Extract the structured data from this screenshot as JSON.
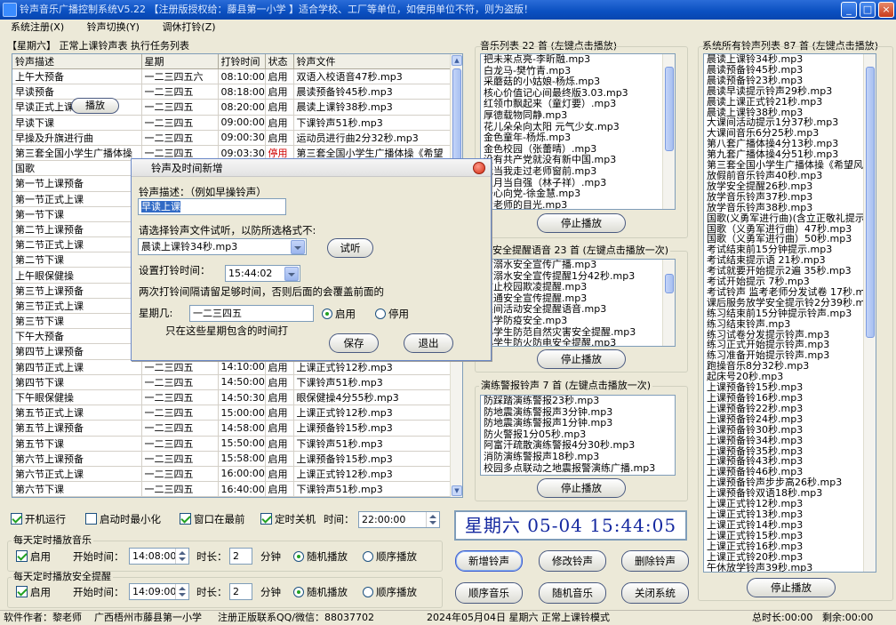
{
  "window": {
    "title": "铃声音乐广播控制系统V5.22 【注册版授权给：藤县第一小学 】适合学校、工厂等单位，如使用单位不符，则为盗版！",
    "btn_min": "_",
    "btn_max": "□",
    "btn_close": "×"
  },
  "menu": [
    "系统注册(X)",
    "铃声切换(Y)",
    "调休打铃(Z)"
  ],
  "schedule": {
    "title": "【星期六】 正常上课铃声表  执行任务列表",
    "columns": [
      "铃声描述",
      "星期",
      "打铃时间",
      "状态",
      "铃声文件"
    ],
    "rows": [
      [
        "上午大预备",
        "一二三四五六",
        "08:10:00",
        "启用",
        "双语入校语音47秒.mp3"
      ],
      [
        "早读预备",
        "一二三四五",
        "08:18:00",
        "启用",
        "晨读预备铃45秒.mp3"
      ],
      [
        "早读正式上课",
        "一二三四五",
        "08:20:00",
        "启用",
        "晨读上课铃38秒.mp3"
      ],
      [
        "早读下课",
        "一二三四五",
        "09:00:00",
        "启用",
        "下课铃声51秒.mp3"
      ],
      [
        "早操及升旗进行曲",
        "一二三四五",
        "09:00:30",
        "启用",
        "运动员进行曲2分32秒.mp3"
      ],
      [
        "第三套全国小学生广播体操",
        "一二三四五",
        "09:03:30",
        "停用",
        "第三套全国小学生广播体操《希望"
      ],
      [
        "国歌",
        "",
        "",
        "",
        ""
      ],
      [
        "第一节上课预备",
        "",
        "",
        "",
        ""
      ],
      [
        "第一节正式上课",
        "",
        "",
        "",
        ""
      ],
      [
        "第一节下课",
        "",
        "",
        "",
        ""
      ],
      [
        "第二节上课预备",
        "",
        "",
        "",
        ""
      ],
      [
        "第二节正式上课",
        "",
        "",
        "",
        ""
      ],
      [
        "第二节下课",
        "",
        "",
        "",
        ""
      ],
      [
        "上午眼保健操",
        "",
        "",
        "",
        ""
      ],
      [
        "第三节上课预备",
        "",
        "",
        "",
        ""
      ],
      [
        "第三节正式上课",
        "",
        "",
        "",
        ""
      ],
      [
        "第三节下课",
        "",
        "",
        "",
        ""
      ],
      [
        "下午大预备",
        "",
        "",
        "",
        ""
      ],
      [
        "第四节上课预备",
        "",
        "",
        "",
        ""
      ],
      [
        "第四节正式上课",
        "一二三四五",
        "14:10:00",
        "启用",
        "上课正式铃12秒.mp3"
      ],
      [
        "第四节下课",
        "一二三四五",
        "14:50:00",
        "启用",
        "下课铃声51秒.mp3"
      ],
      [
        "下午眼保健操",
        "一二三四五",
        "14:50:30",
        "启用",
        "眼保健操4分55秒.mp3"
      ],
      [
        "第五节正式上课",
        "一二三四五",
        "15:00:00",
        "启用",
        "上课正式铃12秒.mp3"
      ],
      [
        "第五节上课预备",
        "一二三四五",
        "14:58:00",
        "启用",
        "上课预备铃15秒.mp3"
      ],
      [
        "第五节下课",
        "一二三四五",
        "15:50:00",
        "启用",
        "下课铃声51秒.mp3"
      ],
      [
        "第六节上课预备",
        "一二三四五",
        "15:58:00",
        "启用",
        "上课预备铃15秒.mp3"
      ],
      [
        "第六节正式上课",
        "一二三四五",
        "16:00:00",
        "启用",
        "上课正式铃12秒.mp3"
      ],
      [
        "第六节下课",
        "一二三四五",
        "16:40:00",
        "启用",
        "下课铃声51秒.mp3"
      ]
    ],
    "play_label": "播放"
  },
  "music": {
    "title": "音乐列表 22 首 (左键点击播放)",
    "items": [
      "把未来点亮-李昕融.mp3",
      "白龙马-樊竹青.mp3",
      "采蘑菇的小姑娘-杨烁.mp3",
      "核心价值记心间最终版3.03.mp3",
      "红领巾飘起来（童灯要）.mp3",
      "厚德载物同静.mp3",
      "花儿朵朵向太阳 元气少女.mp3",
      "金色童年-杨烁.mp3",
      "金色校园（张蕾晴）.mp3",
      "没有共产党就没有新中国.mp3",
      "我当我走过老师窗前.mp3",
      "八月当自强（林子祥）.mp3",
      "一心向党-徐金慧.mp3",
      "爱老师的目光.mp3"
    ],
    "stop": "停止播放"
  },
  "safety": {
    "title": "安全提醒语音 23 首 (左键点击播放一次)",
    "items": [
      "防溺水安全宣传广播.mp3",
      "防溺水安全宣传提醒1分42秒.mp3",
      "防止校园欺凌提醒.mp3",
      "交通安全宣传提醒.mp3",
      "课间活动安全提醒语音.mp3",
      "小学防疫安全.mp3",
      "小学生防范自然灾害安全提醒.mp3",
      "小学生防火防电安全提醒.mp3"
    ],
    "stop": "停止播放"
  },
  "drill": {
    "title": "演练警报铃声 7 首 (左键点击播放一次)",
    "items": [
      "防踩踏演练警报23秒.mp3",
      "防地震演练警报声3分钟.mp3",
      "防地震演练警报声1分钟.mp3",
      "防火警报1分05秒.mp3",
      "阿富汗疏散演练警报4分30秒.mp3",
      "消防演练警报声18秒.mp3",
      "校园多点联动之地震报警演练广播.mp3"
    ],
    "stop": "停止播放"
  },
  "system": {
    "title": "系统所有铃声列表 87 首 (左键点击播放)",
    "items": [
      "晨读上课铃34秒.mp3",
      "晨读预备铃45秒.mp3",
      "晨读预备铃23秒.mp3",
      "晨读早读提示铃声29秒.mp3",
      "晨读上课正式铃21秒.mp3",
      "晨读上课铃38秒.mp3",
      "大课间活动提示1分37秒.mp3",
      "大课间音乐6分25秒.mp3",
      "第八套广播体操4分13秒.mp3",
      "第九套广播体操4分51秒.mp3",
      "第三套全国小学生广播体操《希望风",
      "放假前音乐铃声40秒.mp3",
      "放学安全提醒26秒.mp3",
      "放学音乐铃声37秒.mp3",
      "放学音乐铃声38秒.mp3",
      "国歌(义勇军进行曲)(含立正敬礼提示",
      "国歌（义勇军进行曲）47秒.mp3",
      "国歌（义勇军进行曲）50秒.mp3",
      "考试结束前15分钟提示.mp3",
      "考试结束提示语 21秒.mp3",
      "考试就要开始提示2遍 35秒.mp3",
      "考试开始提示 7秒.mp3",
      "考试铃声 监考老师分发试卷 17秒.mp3",
      "课后服务放学安全提示铃2分39秒.mp3",
      "练习结束前15分钟提示铃声.mp3",
      "练习结束铃声.mp3",
      "练习试卷分发提示铃声.mp3",
      "练习正式开始提示铃声.mp3",
      "练习准备开始提示铃声.mp3",
      "跑操音乐8分32秒.mp3",
      "起床号20秒.mp3",
      "上课预备铃15秒.mp3",
      "上课预备铃16秒.mp3",
      "上课预备铃22秒.mp3",
      "上课预备铃24秒.mp3",
      "上课预备铃30秒.mp3",
      "上课预备铃34秒.mp3",
      "上课预备铃35秒.mp3",
      "上课预备铃43秒.mp3",
      "上课预备铃46秒.mp3",
      "上课预备铃声步步高26秒.mp3",
      "上课预备铃双语18秒.mp3",
      "上课正式铃12秒.mp3",
      "上课正式铃13秒.mp3",
      "上课正式铃14秒.mp3",
      "上课正式铃15秒.mp3",
      "上课正式铃16秒.mp3",
      "上课正式铃20秒.mp3",
      "午休放学铃声39秒.mp3"
    ],
    "stop": "停止播放"
  },
  "dialog": {
    "title": "铃声及时间新增",
    "desc_label": "铃声描述：（例如早操铃声）",
    "desc_value": "早读上课",
    "file_label": "请选择铃声文件试听，以防所选格式不:",
    "file_value": "晨读上课铃34秒.mp3",
    "preview": "试听",
    "time_label": "设置打铃时间：",
    "time_value": "15:44:02",
    "note": "两次打铃间隔请留足够时间，否则后面的会覆盖前面的",
    "weekday_label": "星期几:",
    "weekday_value": "一二三四五",
    "enable": "启用",
    "disable": "停用",
    "hint": "只在这些星期包含的时间打",
    "save": "保存",
    "exit": "退出"
  },
  "options": {
    "auto_run": "开机运行",
    "start_min": "启动时最小化",
    "topmost": "窗口在最前",
    "shutdown": "定时关机",
    "time_label": "时间：",
    "shutdown_time": "22:00:00"
  },
  "daily_music": {
    "title": "每天定时播放音乐",
    "enable": "启用",
    "start_label": "开始时间：",
    "start": "14:08:00",
    "dur_label": "时长：",
    "dur": "2",
    "min": "分钟",
    "random": "随机播放",
    "order": "顺序播放"
  },
  "daily_safety": {
    "title": "每天定时播放安全提醒",
    "enable": "启用",
    "start_label": "开始时间：",
    "start": "14:09:00",
    "dur_label": "时长：",
    "dur": "2",
    "min": "分钟",
    "random": "随机播放",
    "order": "顺序播放"
  },
  "clock": "星期六  05-04  15:44:05",
  "buttons": {
    "add": "新增铃声",
    "edit": "修改铃声",
    "delete": "删除铃声",
    "order_music": "顺序音乐",
    "random_music": "随机音乐",
    "close": "关闭系统"
  },
  "status": {
    "author": "软件作者：黎老师",
    "school": "广西梧州市藤县第一小学",
    "contact": "注册正版联系QQ/微信：88037702",
    "date_mode": "2024年05月04日  星期六  正常上课铃模式",
    "total": "总时长:00:00",
    "remain": "剩余:00:00"
  },
  "colors": {
    "accent": "#0a4fc0",
    "disabled": "#d00000",
    "clock": "#1428a0"
  }
}
